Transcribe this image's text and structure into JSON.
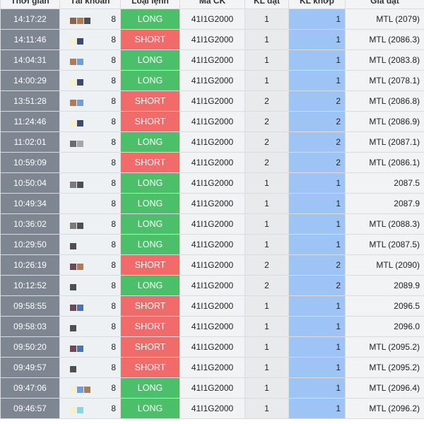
{
  "columns": [
    "Thời gian",
    "Tài khoản",
    "Loại lệnh",
    "Mã CK",
    "KL đặt",
    "KL khớp",
    "Giá đặt"
  ],
  "colors": {
    "time_bg": "#7e8691",
    "long_bg": "#4cbf6a",
    "short_bg": "#f26b6b",
    "fill_bg": "#9ec3f5"
  },
  "rows": [
    {
      "time": "14:17:22",
      "acct": "8",
      "blots": [
        "#7a4a2e",
        "#a0683a",
        "#333333"
      ],
      "type": "LONG",
      "code": "41I1G2000",
      "vol": "1",
      "fill": "1",
      "price": "MTL (2079)"
    },
    {
      "time": "14:11:46",
      "acct": "8",
      "blots": [
        "#f6f2c6",
        "#1f2d5a"
      ],
      "type": "SHORT",
      "code": "41I1G2000",
      "vol": "1",
      "fill": "1",
      "price": "MTL (2086.3)"
    },
    {
      "time": "14:04:31",
      "acct": "8",
      "blots": [
        "#a0683a",
        "#5b8fd6"
      ],
      "type": "LONG",
      "code": "41I1G2000",
      "vol": "1",
      "fill": "1",
      "price": "MTL (2083.8)"
    },
    {
      "time": "14:00:29",
      "acct": "8",
      "blots": [
        "#f6f2c6",
        "#1f2d5a"
      ],
      "type": "LONG",
      "code": "41I1G2000",
      "vol": "1",
      "fill": "1",
      "price": "MTL (2078.1)"
    },
    {
      "time": "13:51:28",
      "acct": "8",
      "blots": [
        "#a0683a",
        "#5b8fd6"
      ],
      "type": "SHORT",
      "code": "41I1G2000",
      "vol": "2",
      "fill": "2",
      "price": "MTL (2086.8)"
    },
    {
      "time": "11:24:46",
      "acct": "8",
      "blots": [
        "#f6f2c6",
        "#1f2d5a"
      ],
      "type": "SHORT",
      "code": "41I1G2000",
      "vol": "2",
      "fill": "2",
      "price": "MTL (2086.9)"
    },
    {
      "time": "11:02:01",
      "acct": "8",
      "blots": [
        "#555555",
        "#999999"
      ],
      "type": "LONG",
      "code": "41I1G2000",
      "vol": "2",
      "fill": "2",
      "price": "MTL (2087.1)"
    },
    {
      "time": "10:59:09",
      "acct": "8",
      "blots": [],
      "type": "SHORT",
      "code": "41I1G2000",
      "vol": "2",
      "fill": "2",
      "price": "MTL (2086.1)"
    },
    {
      "time": "10:50:04",
      "acct": "8",
      "blots": [
        "#666666",
        "#333333"
      ],
      "type": "LONG",
      "code": "41I1G2000",
      "vol": "1",
      "fill": "1",
      "price": "2087.5"
    },
    {
      "time": "10:49:34",
      "acct": "8",
      "blots": [],
      "type": "LONG",
      "code": "41I1G2000",
      "vol": "1",
      "fill": "1",
      "price": "2087.9"
    },
    {
      "time": "10:36:02",
      "acct": "8",
      "blots": [
        "#666666",
        "#333333"
      ],
      "type": "LONG",
      "code": "41I1G2000",
      "vol": "1",
      "fill": "1",
      "price": "MTL (2088.3)"
    },
    {
      "time": "10:29:50",
      "acct": "8",
      "blots": [
        "#333333"
      ],
      "type": "LONG",
      "code": "41I1G2000",
      "vol": "1",
      "fill": "1",
      "price": "MTL (2087.5)"
    },
    {
      "time": "10:26:19",
      "acct": "8",
      "blots": [
        "#5a2a3e",
        "#a0683a"
      ],
      "type": "SHORT",
      "code": "41I1G2000",
      "vol": "2",
      "fill": "2",
      "price": "MTL (2090)"
    },
    {
      "time": "10:12:52",
      "acct": "8",
      "blots": [
        "#333333"
      ],
      "type": "LONG",
      "code": "41I1G2000",
      "vol": "2",
      "fill": "2",
      "price": "2089.9"
    },
    {
      "time": "09:58:55",
      "acct": "8",
      "blots": [
        "#5a2a3e",
        "#2f5ea8"
      ],
      "type": "SHORT",
      "code": "41I1G2000",
      "vol": "1",
      "fill": "1",
      "price": "2096.5"
    },
    {
      "time": "09:58:03",
      "acct": "8",
      "blots": [
        "#333333"
      ],
      "type": "SHORT",
      "code": "41I1G2000",
      "vol": "1",
      "fill": "1",
      "price": "2096.0"
    },
    {
      "time": "09:50:20",
      "acct": "8",
      "blots": [
        "#5a2a3e",
        "#2f5ea8"
      ],
      "type": "SHORT",
      "code": "41I1G2000",
      "vol": "1",
      "fill": "1",
      "price": "MTL (2095.2)"
    },
    {
      "time": "09:49:57",
      "acct": "8",
      "blots": [
        "#333333"
      ],
      "type": "SHORT",
      "code": "41I1G2000",
      "vol": "1",
      "fill": "1",
      "price": "MTL (2095.2)"
    },
    {
      "time": "09:47:06",
      "acct": "8",
      "blots": [
        "#f6f2c6",
        "#5b8fd6",
        "#a0683a"
      ],
      "type": "LONG",
      "code": "41I1G2000",
      "vol": "1",
      "fill": "1",
      "price": "MTL (2096.4)"
    },
    {
      "time": "09:46:57",
      "acct": "8",
      "blots": [
        "#f6f2c6",
        "#7ad0e0"
      ],
      "type": "LONG",
      "code": "41I1G2000",
      "vol": "1",
      "fill": "1",
      "price": "MTL (2096.2)"
    }
  ]
}
